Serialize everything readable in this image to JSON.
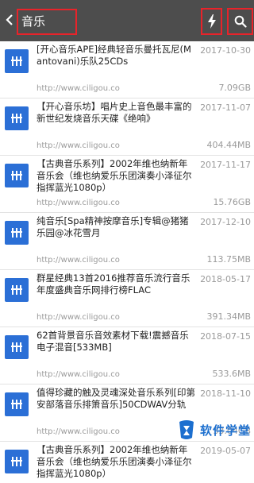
{
  "header": {
    "back_icon": "back-chevron-icon",
    "search_query": "音乐",
    "flash_icon": "lightning-icon",
    "search_icon": "search-icon"
  },
  "results": [
    {
      "title": "[开心音乐APE]经典轻音乐曼托瓦尼(Mantovani)乐队25CDs",
      "date": "2017-10-30",
      "url": "http://www.ciligou.co",
      "size": "7.09GB"
    },
    {
      "title": "【开心音乐坊】唱片史上音色最丰富的新世纪发烧音乐天碟《绝响》",
      "date": "2017-11-07",
      "url": "http://www.ciligou.co",
      "size": "404.44MB"
    },
    {
      "title": "【古典音乐系列】2002年维也纳新年音乐会（维也纳爱乐乐团演奏小泽征尔指挥蓝光1080p）",
      "date": "2017-11-17",
      "url": "http://www.ciligou.co",
      "size": "15.76GB"
    },
    {
      "title": "纯音乐[Spa精神按摩音乐]专辑@猪猪乐园@冰花雪月",
      "date": "2017-12-10",
      "url": "http://www.ciligou.co",
      "size": "113.75MB"
    },
    {
      "title": "群星经典13首2016推荐音乐流行音乐年度盛典音乐网排行榜FLAC",
      "date": "2018-05-17",
      "url": "http://www.ciligou.co",
      "size": "391.34MB"
    },
    {
      "title": "62首背景音乐音效素材下载!震撼音乐电子混音[533MB]",
      "date": "2018-07-15",
      "url": "http://www.ciligou.co",
      "size": "533.6MB"
    },
    {
      "title": "值得珍藏的触及灵魂深处音乐系列[印第安部落音乐排箫音乐]50CDWAV分轨",
      "date": "2018-11-10",
      "url": "http://www.ciligou.co",
      "size": "33.04GB"
    },
    {
      "title": "【古典音乐系列】2002年维也纳新年音乐会（维也纳爱乐乐团演奏小泽征尔指挥蓝光1080p）",
      "date": "2019-05-07",
      "url": "",
      "size": ""
    }
  ],
  "watermark": {
    "text": "软件学堂"
  },
  "colors": {
    "header_bg": "#4d4d4d",
    "highlight_border": "#e8232a",
    "thumb_blue": "#2b6fd6",
    "meta_gray": "#9a9a9a"
  }
}
